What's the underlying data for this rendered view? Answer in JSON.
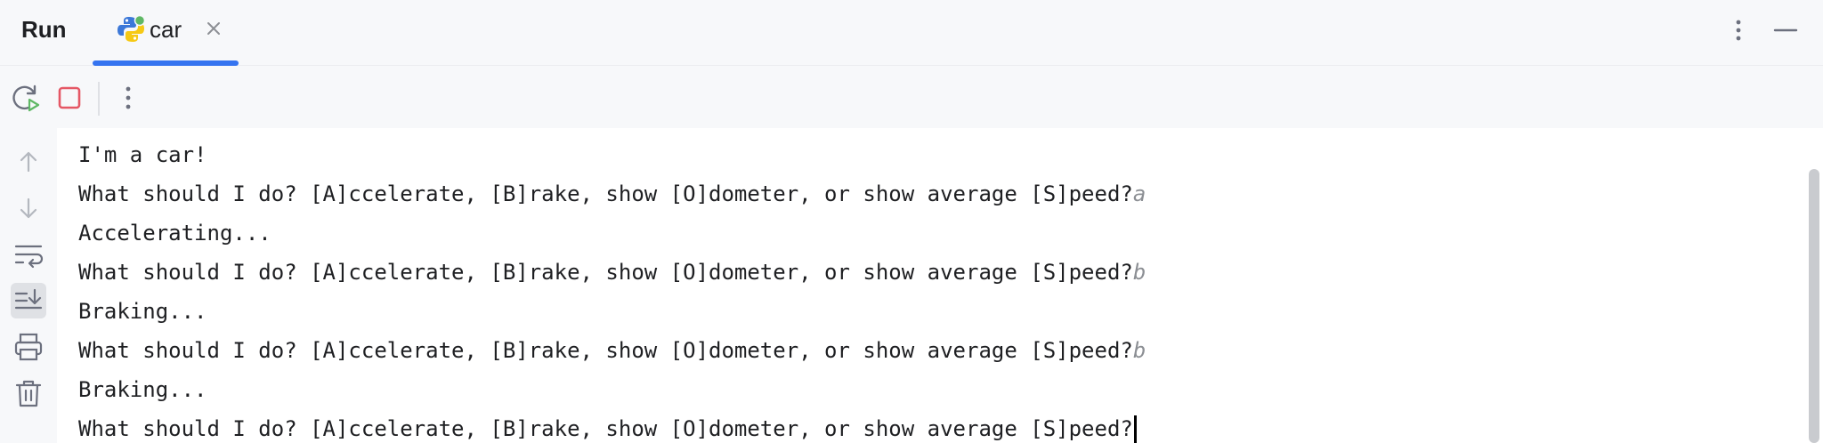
{
  "header": {
    "title": "Run",
    "tab": {
      "label": "car",
      "icon": "python-icon"
    }
  },
  "toolbar": {
    "items": [
      "rerun-icon",
      "stop-icon",
      "more-vertical-icon"
    ]
  },
  "gutter": {
    "items": [
      "arrow-up-icon",
      "arrow-down-icon",
      "soft-wrap-icon",
      "scroll-to-end-icon",
      "print-icon",
      "trash-icon"
    ]
  },
  "console": {
    "lines": [
      {
        "text": "I'm a car!",
        "input": ""
      },
      {
        "text": "What should I do? [A]ccelerate, [B]rake, show [O]dometer, or show average [S]peed?",
        "input": "a"
      },
      {
        "text": "Accelerating...",
        "input": ""
      },
      {
        "text": "What should I do? [A]ccelerate, [B]rake, show [O]dometer, or show average [S]peed?",
        "input": "b"
      },
      {
        "text": "Braking...",
        "input": ""
      },
      {
        "text": "What should I do? [A]ccelerate, [B]rake, show [O]dometer, or show average [S]peed?",
        "input": "b"
      },
      {
        "text": "Braking...",
        "input": ""
      },
      {
        "text": "What should I do? [A]ccelerate, [B]rake, show [O]dometer, or show average [S]peed?",
        "input": ""
      }
    ]
  },
  "colors": {
    "accent": "#3574f0",
    "stop": "#e55765",
    "rerun": "#5fb865",
    "python_blue": "#3c78d8",
    "python_yellow": "#f6c915"
  }
}
